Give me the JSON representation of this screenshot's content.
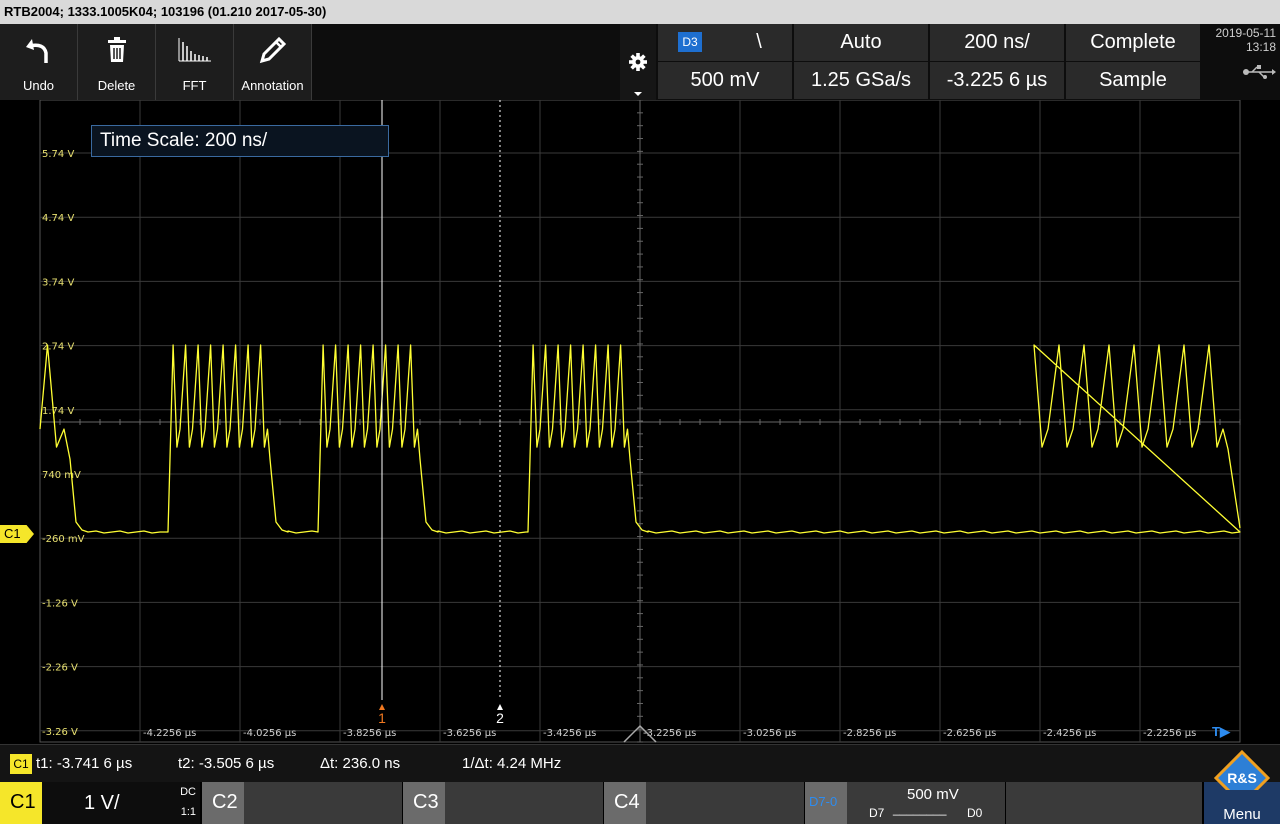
{
  "title_bar": {
    "text": "RTB2004; 1333.1005K04; 103196 (01.210 2017-05-30)"
  },
  "toolbar": {
    "buttons": [
      {
        "label": "Undo",
        "icon": "undo-arrow-icon"
      },
      {
        "label": "Delete",
        "icon": "trash-icon"
      },
      {
        "label": "FFT",
        "icon": "fft-spectrum-icon"
      },
      {
        "label": "Annotation",
        "icon": "pencil-icon"
      }
    ],
    "settings_icon": "gear-icon"
  },
  "acquisition": {
    "channel_badge": "D3",
    "edge_symbol": "\\",
    "trigger_mode": "Auto",
    "time_scale": "200 ns/",
    "acq_state": "Complete",
    "trigger_level": "500 mV",
    "sample_rate": "1.25 GSa/s",
    "horizontal_position": "-3.225 6 µs",
    "acq_mode": "Sample"
  },
  "datetime": {
    "date": "2019-05-11",
    "time": "13:18",
    "usb_icon": "usb-icon"
  },
  "tooltip": {
    "text": "Time Scale: 200 ns/"
  },
  "waveform": {
    "channel_marker": "C1",
    "color": "#ffff33",
    "voltage_labels": [
      "5.74 V",
      "4.74 V",
      "3.74 V",
      "2.74 V",
      "1.74 V",
      "740 mV",
      "-260 mV",
      "-1.26 V",
      "-2.26 V",
      "-3.26 V"
    ],
    "time_labels": [
      "-4.2256 µs",
      "-4.0256 µs",
      "-3.8256 µs",
      "-3.6256 µs",
      "-3.4256 µs",
      "-3.2256 µs",
      "-3.0256 µs",
      "-2.8256 µs",
      "-2.6256 µs",
      "-2.4256 µs",
      "-2.2256 µs"
    ],
    "cursor1_label": "1",
    "cursor2_label": "2",
    "cursor_t1_us": -3.7416,
    "cursor_t2_us": -3.5056,
    "t_arrow": "T▶",
    "bursts": [
      {
        "start_us": -4.4256,
        "end_us": -4.3656,
        "peaks": 1,
        "partial": true
      },
      {
        "start_us": -4.1656,
        "end_us": -3.9656,
        "peaks": 8
      },
      {
        "start_us": -3.8656,
        "end_us": -3.6656,
        "peaks": 8
      },
      {
        "start_us": -3.4456,
        "end_us": -3.2456,
        "peaks": 8
      }
    ],
    "high_v": 2.74,
    "low_v": -0.26
  },
  "measurements": {
    "channel_badge": "C1",
    "t1": "t1: -3.741 6 µs",
    "t2": "t2: -3.505 6 µs",
    "dt": "Δt: 236.0 ns",
    "inv_dt": "1/Δt: 4.24 MHz"
  },
  "channels": {
    "c1": {
      "label": "C1",
      "scale": "1 V/",
      "coupling": "DC",
      "ratio": "1:1"
    },
    "c2": {
      "label": "C2"
    },
    "c3": {
      "label": "C3"
    },
    "c4": {
      "label": "C4"
    },
    "digital": {
      "label": "D7-0",
      "level": "500 mV",
      "range_left": "D7",
      "range_right": "D0",
      "dashes": "________"
    }
  },
  "menu": {
    "label": "Menu",
    "logo_text": "R&S"
  }
}
